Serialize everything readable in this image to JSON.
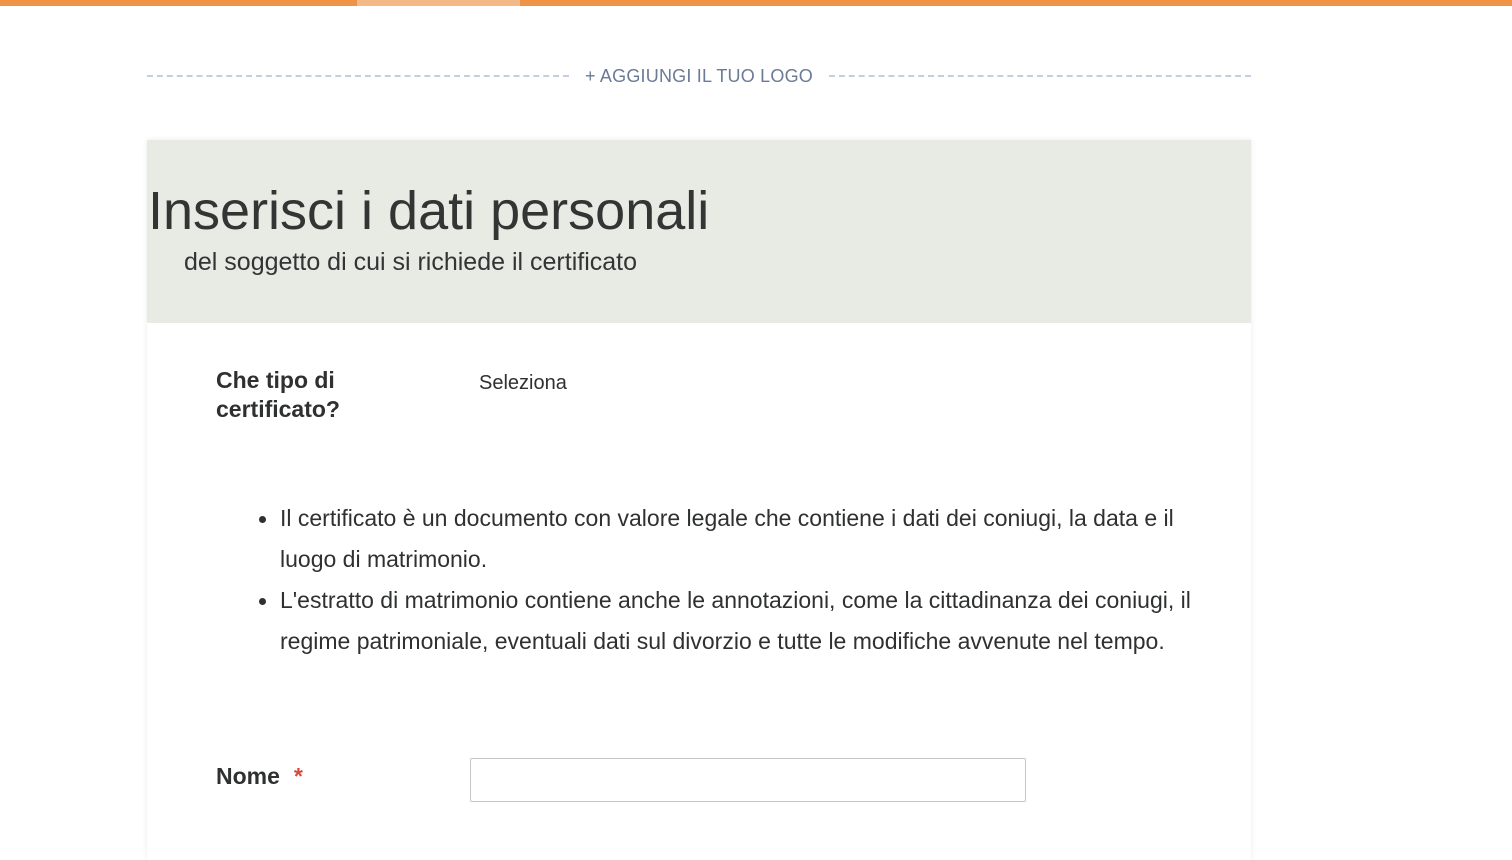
{
  "progress": {
    "color": "#ef9346",
    "segment_color": "#f3b987"
  },
  "logo": {
    "label": "+ AGGIUNGI IL TUO LOGO"
  },
  "header": {
    "title": "Inserisci i dati personali",
    "subtitle": "del soggetto di cui si richiede il certificato",
    "background": "#e8eae4"
  },
  "question": {
    "label": "Che tipo di certificato?",
    "select_value": "Seleziona"
  },
  "info": {
    "items": [
      "Il certificato è un documento con valore legale che contiene i dati dei coniugi, la data e il luogo di matrimonio.",
      "L'estratto di matrimonio contiene anche le annotazioni, come la cittadinanza dei coniugi, il regime patrimoniale, eventuali dati sul divorzio e tutte le modifiche avvenute nel tempo."
    ]
  },
  "nome": {
    "label": "Nome",
    "required_marker": "*",
    "value": "",
    "required_color": "#d9483b"
  }
}
